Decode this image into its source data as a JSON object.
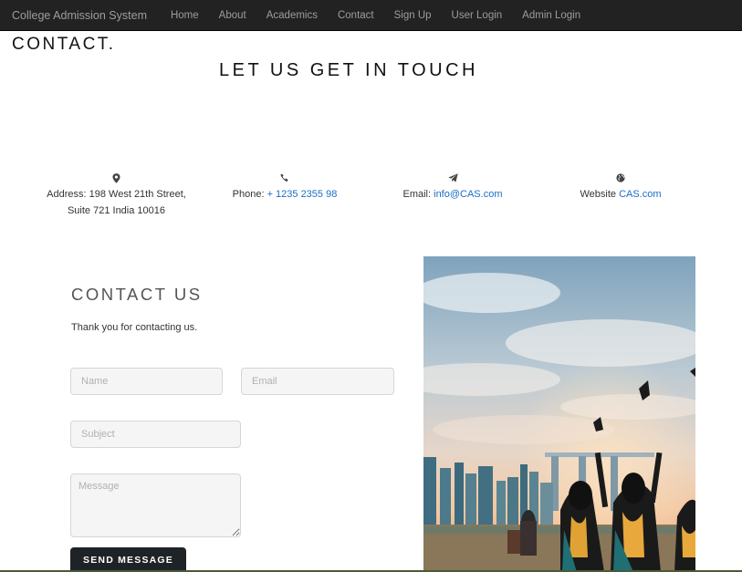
{
  "navbar": {
    "brand": "College Admission System",
    "links": [
      "Home",
      "About",
      "Academics",
      "Contact",
      "Sign Up",
      "User Login",
      "Admin Login"
    ]
  },
  "page": {
    "heading": "CONTACT.",
    "subheading": "LET US GET IN TOUCH"
  },
  "contact_info": {
    "address": {
      "icon": "map-marker-icon",
      "line1": "Address: 198 West 21th Street,",
      "line2": "Suite 721 India 10016"
    },
    "phone": {
      "icon": "phone-icon",
      "label": "Phone: ",
      "value": "+ 1235 2355 98"
    },
    "email": {
      "icon": "paper-plane-icon",
      "label": "Email: ",
      "value": "info@CAS.com"
    },
    "website": {
      "icon": "globe-icon",
      "label": "Website ",
      "value": "CAS.com"
    }
  },
  "form": {
    "title": "CONTACT US",
    "thanks": "Thank you for contacting us.",
    "name_placeholder": "Name",
    "email_placeholder": "Email",
    "subject_placeholder": "Subject",
    "message_placeholder": "Message",
    "submit_label": "SEND MESSAGE"
  },
  "colors": {
    "navbar_bg": "#222222",
    "link": "#1a6ec7",
    "button_bg": "#1e2327"
  }
}
